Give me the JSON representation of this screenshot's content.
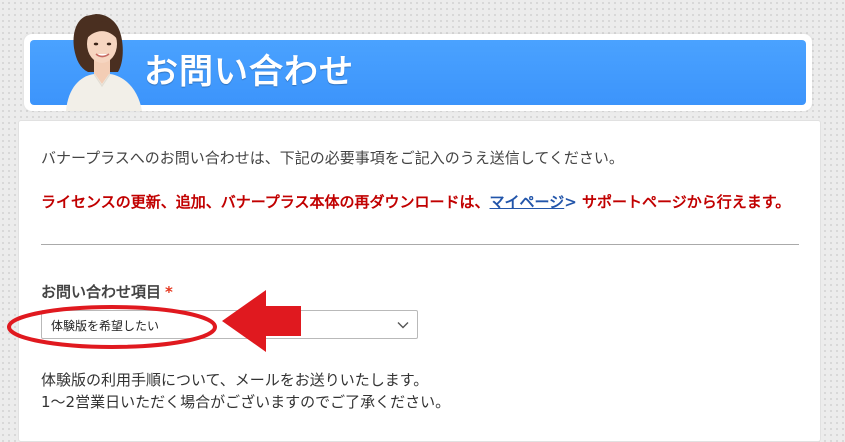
{
  "header": {
    "title": "お問い合わせ"
  },
  "form": {
    "intro": "バナープラスへのお問い合わせは、下記の必要事項をご記入のうえ送信してください。",
    "notice_before": "ライセンスの更新、追加、バナープラス本体の再ダウンロードは、",
    "notice_link": "マイページ",
    "notice_gt": ">",
    "notice_after": " サポートページから行えます。",
    "field_label": "お問い合わせ項目",
    "required_mark": "*",
    "select_value": "体験版を希望したい",
    "description_line1": "体験版の利用手順について、メールをお送りいたします。",
    "description_line2": "1～2営業日いただく場合がございますのでご了承ください。"
  },
  "icons": {
    "avatar": "woman-avatar-icon",
    "dropdown": "chevron-down-icon",
    "annotation_arrow": "red-arrow-icon",
    "annotation_ellipse": "red-ellipse-highlight"
  },
  "colors": {
    "banner_blue": "#3c94fb",
    "notice_red": "#c10000",
    "link_blue": "#2255aa",
    "required_red": "#e5351d",
    "annotation_red": "#e0191f"
  }
}
